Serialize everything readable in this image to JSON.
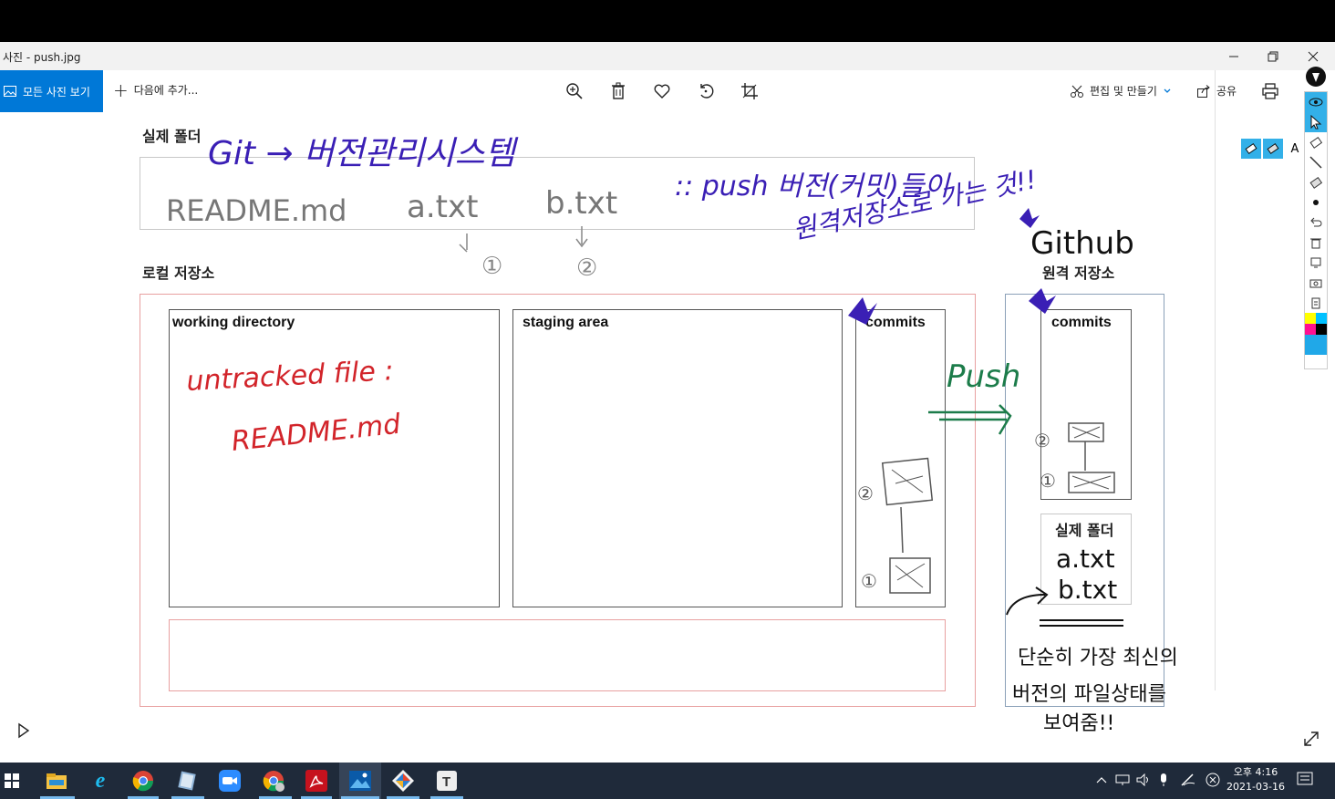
{
  "window": {
    "title": "사진 - push.jpg"
  },
  "toolbar": {
    "all_photos": "모든 사진 보기",
    "add_to": "다음에 추가...",
    "edit_create": "편집 및 만들기",
    "share": "공유"
  },
  "slide": {
    "real_folder_heading": "실제 폴더",
    "local_repo_heading": "로컬 저장소",
    "remote_repo_heading": "원격 저장소",
    "working_directory": "working directory",
    "staging_area": "staging area",
    "commits_local": "commits",
    "commits_remote": "commits",
    "remote_real_folder": "실제 폴더"
  },
  "handwriting": {
    "git_title": "Git → 버전관리시스템",
    "files": [
      "README.md",
      "a.txt",
      "b.txt"
    ],
    "push_note_line1": ":: push 버전(커밋)들이",
    "push_note_line2": "원격저장소로 가는 것!!",
    "github": "Github",
    "step1": "①",
    "step2": "②",
    "untracked_line1": "untracked file :",
    "untracked_line2": "README.md",
    "push_label": "Push",
    "remote_files": [
      "a.txt",
      "b.txt"
    ],
    "remote_note_line1": "단순히 가장 최신의",
    "remote_note_line2": "버전의 파일상태를",
    "remote_note_line3": "보여줌!!"
  },
  "palette": {
    "text_tool": "A"
  },
  "taskbar": {
    "clock_time": "오후 4:16",
    "clock_date": "2021-03-16",
    "apps": [
      "file-explorer",
      "internet-explorer",
      "chrome",
      "notes",
      "zoom",
      "chrome-alt",
      "acrobat",
      "photos",
      "git",
      "typora"
    ]
  },
  "colors": {
    "accent": "#0078d7",
    "ink_purple": "#3a1fb5",
    "ink_red": "#d2242a",
    "ink_green": "#1c7c4a",
    "ink_black": "#111111",
    "ink_gray": "#555555"
  }
}
